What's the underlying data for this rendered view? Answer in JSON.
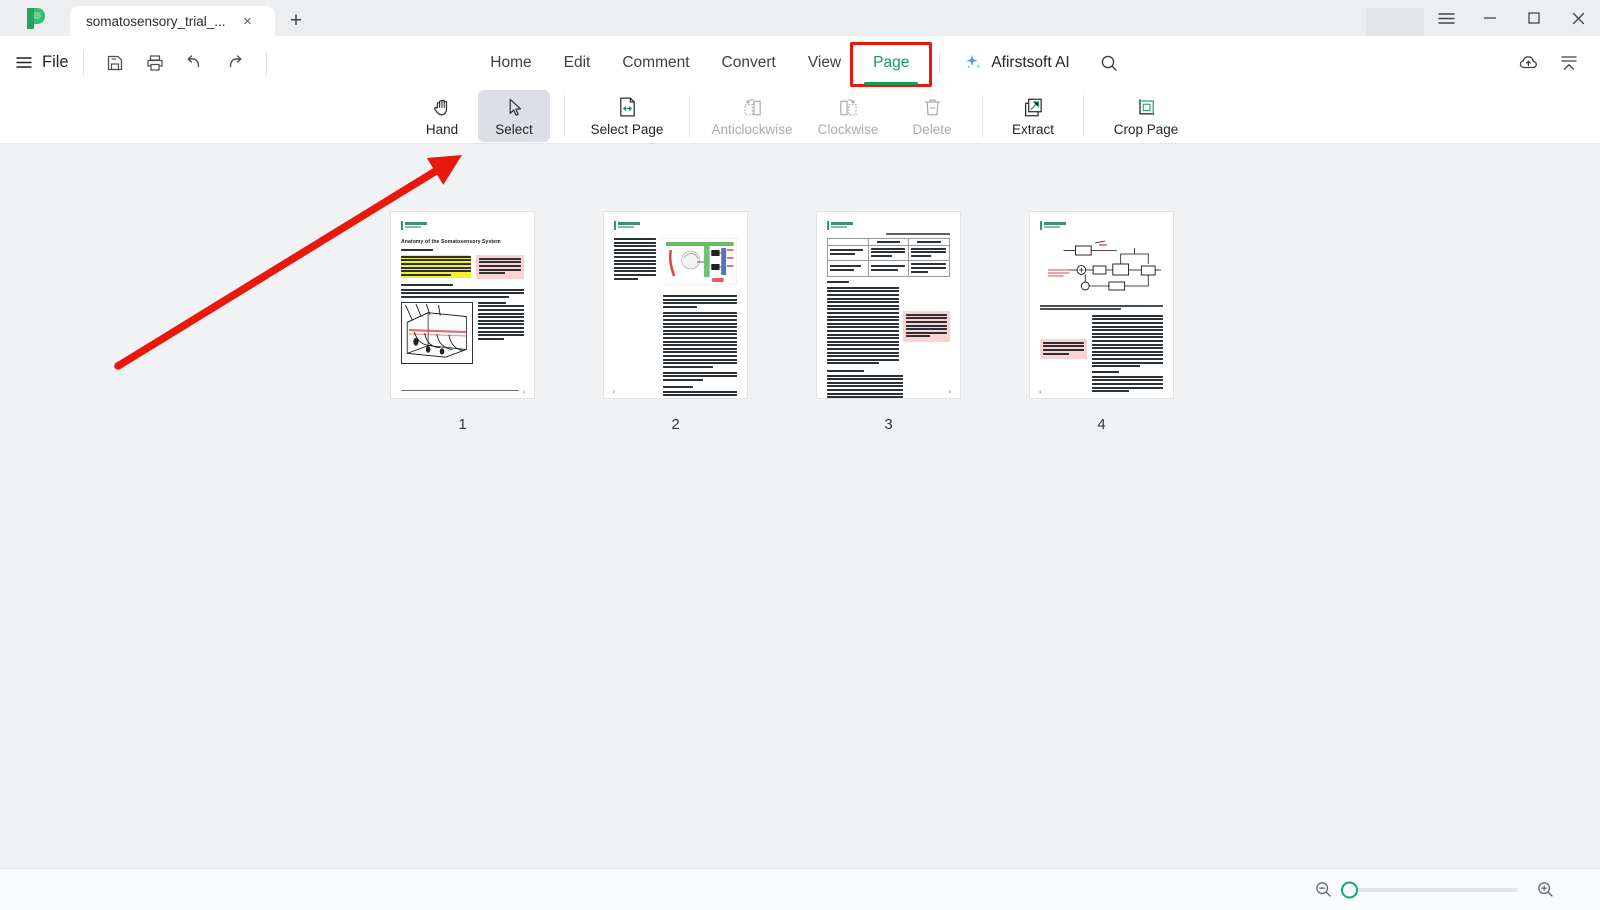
{
  "window": {
    "tab_title": "somatosensory_trial_...",
    "new_tab_label": "+",
    "close_tab_label": "×",
    "menu_icon": "hamburger-icon",
    "minimize_label": "—",
    "maximize_label": "□",
    "close_label": "×",
    "logo": "afirstsoft-logo"
  },
  "menubar": {
    "file_label": "File",
    "quick_actions": [
      {
        "name": "save-icon",
        "label": "Save"
      },
      {
        "name": "print-icon",
        "label": "Print"
      },
      {
        "name": "undo-icon",
        "label": "Undo"
      },
      {
        "name": "redo-icon",
        "label": "Redo"
      }
    ],
    "items": [
      {
        "label": "Home",
        "active": false
      },
      {
        "label": "Edit",
        "active": false
      },
      {
        "label": "Comment",
        "active": false
      },
      {
        "label": "Convert",
        "active": false
      },
      {
        "label": "View",
        "active": false
      },
      {
        "label": "Page",
        "active": true
      }
    ],
    "ai_label": "Afirstsoft AI",
    "search_icon": "search-icon",
    "right_icons": [
      {
        "name": "cloud-upload-icon",
        "label": "Upload"
      },
      {
        "name": "collapse-ribbon-icon",
        "label": "Collapse"
      }
    ]
  },
  "ribbon": {
    "tools": [
      {
        "label": "Hand",
        "icon": "hand-icon",
        "state": "enabled"
      },
      {
        "label": "Select",
        "icon": "cursor-arrow-icon",
        "state": "selected"
      },
      {
        "label": "Select Page",
        "icon": "select-page-icon",
        "state": "enabled"
      },
      {
        "label": "Anticlockwise",
        "icon": "rotate-left-icon",
        "state": "disabled"
      },
      {
        "label": "Clockwise",
        "icon": "rotate-right-icon",
        "state": "disabled"
      },
      {
        "label": "Delete",
        "icon": "trash-icon",
        "state": "disabled"
      },
      {
        "label": "Extract",
        "icon": "extract-icon",
        "state": "enabled"
      },
      {
        "label": "Crop Page",
        "icon": "crop-icon",
        "state": "enabled"
      }
    ]
  },
  "pages": [
    {
      "number": "1",
      "title": "Anatomy of the Somatosensory System"
    },
    {
      "number": "2",
      "title": ""
    },
    {
      "number": "3",
      "title": ""
    },
    {
      "number": "4",
      "title": ""
    }
  ],
  "annotation": {
    "arrow_color": "#e8180c",
    "highlight_color": "#e8180c",
    "points_to": "Select"
  },
  "statusbar": {
    "zoom_out_icon": "zoom-out-icon",
    "zoom_in_icon": "zoom-in-icon",
    "zoom_value": "0"
  },
  "colors": {
    "accent_green": "#0f9d58",
    "annotation_red": "#e8180c",
    "ai_blue": "#3f8ef7",
    "page_bg": "#f1f2f4"
  }
}
